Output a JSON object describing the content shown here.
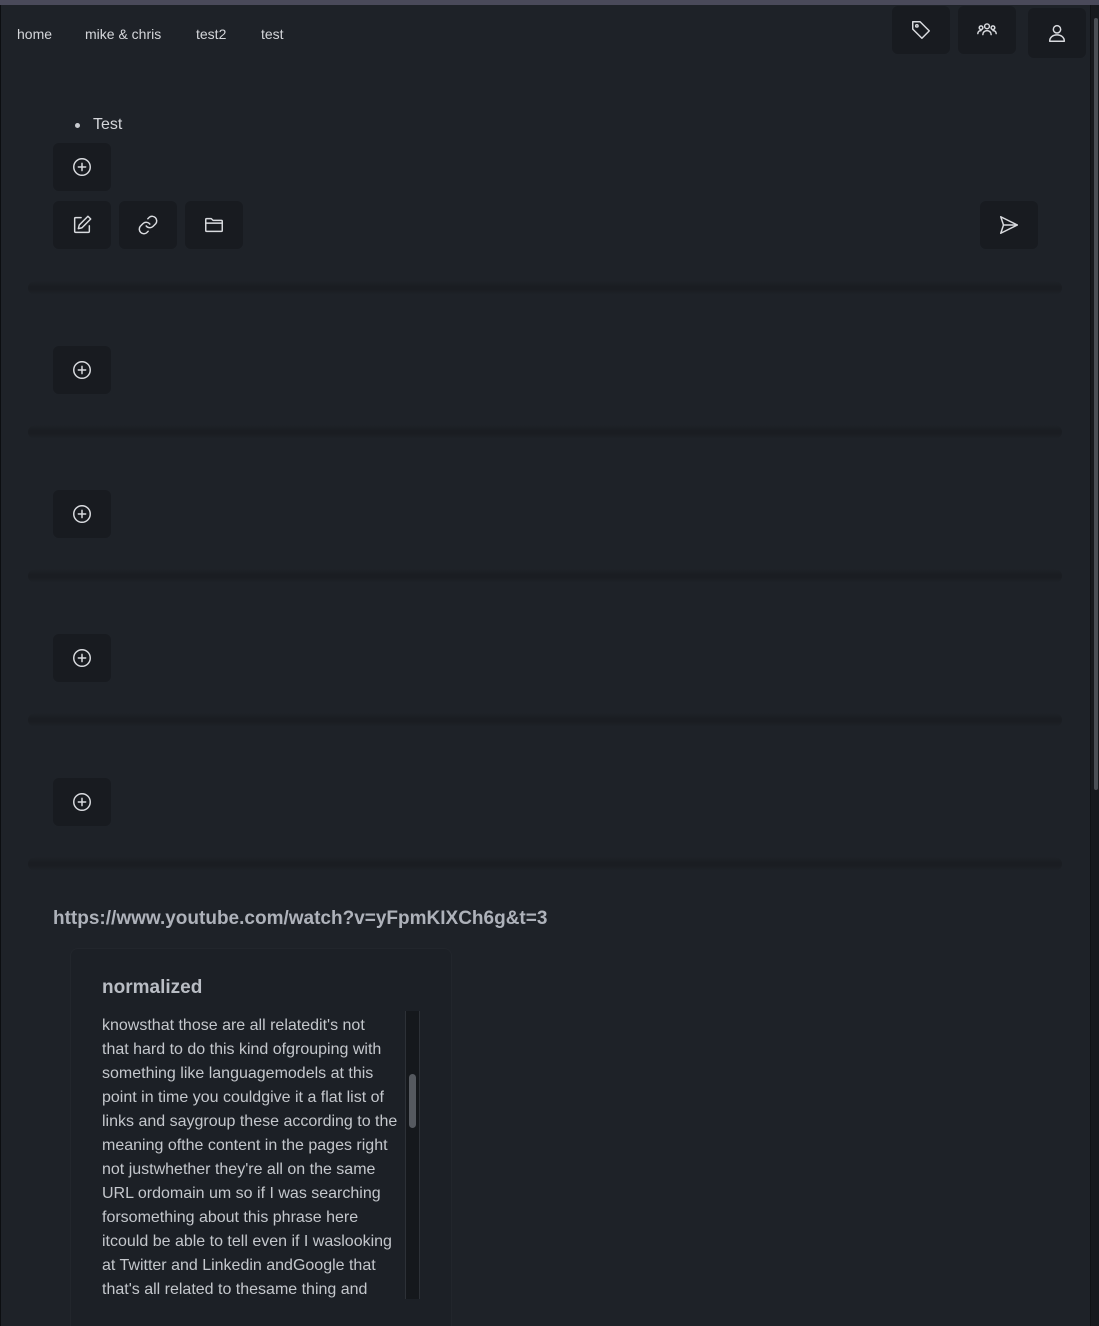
{
  "nav": {
    "links": [
      "home",
      "mike & chris",
      "test2",
      "test"
    ]
  },
  "header_icons": [
    "tag-icon",
    "users-icon",
    "user-icon"
  ],
  "note": {
    "bullet_text": "Test"
  },
  "toolbar_icons": [
    "edit-icon",
    "link-icon",
    "folder-icon",
    "send-icon"
  ],
  "link_item": {
    "url": "https://www.youtube.com/watch?v=yFpmKIXCh6g&t=3",
    "card_title": "normalized",
    "transcript": [
      "knowsthat those are all relatedit's not",
      "that hard to do this kind ofgrouping with",
      "something like languagemodels at this",
      "point in time you couldgive it a flat list of",
      "links and saygroup these according to the",
      "meaning ofthe content in the pages right",
      "not justwhether they're all on the same",
      "URL ordomain um so if I was searching",
      "forsomething about this phrase here",
      "itcould be able to tell even if I waslooking",
      "at Twitter and Linkedin andGoogle that",
      "that's all related to thesame thing and"
    ]
  },
  "colors": {
    "background": "#1e2228",
    "button_bg": "#181b20",
    "text": "#c9ccd1"
  }
}
